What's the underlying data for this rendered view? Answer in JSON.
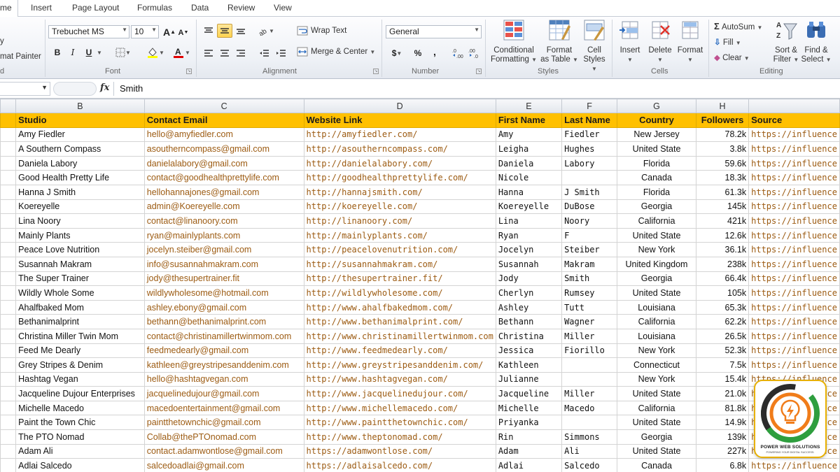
{
  "tabs": [
    {
      "label": "me",
      "active": true
    },
    {
      "label": "Insert"
    },
    {
      "label": "Page Layout"
    },
    {
      "label": "Formulas"
    },
    {
      "label": "Data"
    },
    {
      "label": "Review"
    },
    {
      "label": "View"
    }
  ],
  "clipboard": {
    "cut_partial": "y",
    "format_painter_partial": "mat Painter",
    "label_partial": "d"
  },
  "font": {
    "family": "Trebuchet MS",
    "size": "10",
    "label": "Font",
    "bold": "B",
    "italic": "I",
    "underline": "U"
  },
  "alignment": {
    "wrap_text": "Wrap Text",
    "merge_center": "Merge & Center",
    "label": "Alignment"
  },
  "number": {
    "format": "General",
    "label": "Number",
    "currency": "$",
    "percent": "%",
    "comma": ","
  },
  "styles": {
    "conditional_formatting": [
      "Conditional",
      "Formatting"
    ],
    "format_as_table": [
      "Format",
      "as Table"
    ],
    "cell_styles": [
      "Cell",
      "Styles"
    ],
    "label": "Styles"
  },
  "cells": {
    "insert": "Insert",
    "delete": "Delete",
    "format": "Format",
    "label": "Cells"
  },
  "editing": {
    "autosum": "AutoSum",
    "fill": "Fill",
    "clear": "Clear",
    "sort_filter": [
      "Sort &",
      "Filter"
    ],
    "find_select": [
      "Find &",
      "Select"
    ],
    "label": "Editing"
  },
  "formula_bar": {
    "fx": "fx",
    "value": "Smith"
  },
  "columns": [
    "B",
    "C",
    "D",
    "E",
    "F",
    "G",
    "H",
    ""
  ],
  "header_row": [
    "Studio",
    "Contact Email",
    "Website Link",
    "First Name",
    "Last Name",
    "Country",
    "Followers",
    "Source"
  ],
  "rows": [
    [
      "Amy Fiedler",
      "hello@amyfiedler.com",
      "http://amyfiedler.com/",
      "Amy",
      "Fiedler",
      "New Jersey",
      "78.2k",
      "https://influence"
    ],
    [
      "A Southern Compass",
      "asoutherncompass@gmail.com",
      "http://asoutherncompass.com/",
      "Leigha",
      "Hughes",
      "United State",
      "3.8k",
      "https://influence"
    ],
    [
      "Daniela Labory",
      "danielalabory@gmail.com",
      "http://danielalabory.com/",
      "Daniela",
      "Labory",
      "Florida",
      "59.6k",
      "https://influence"
    ],
    [
      "Good Health Pretty Life",
      "contact@goodhealthprettylife.com",
      "http://goodhealthprettylife.com/",
      "Nicole",
      "",
      "Canada",
      "18.3k",
      "https://influence"
    ],
    [
      "Hanna J Smith",
      "hellohannajones@gmail.com",
      "http://hannajsmith.com/",
      "Hanna",
      "J Smith",
      "Florida",
      "61.3k",
      "https://influence"
    ],
    [
      "Koereyelle",
      "admin@Koereyelle.com",
      "http://koereyelle.com/",
      "Koereyelle",
      "DuBose",
      "Georgia",
      "145k",
      "https://influence"
    ],
    [
      "Lina Noory",
      "contact@linanoory.com",
      "http://linanoory.com/",
      "Lina",
      "Noory",
      "California",
      "421k",
      "https://influence"
    ],
    [
      "Mainly Plants",
      "ryan@mainlyplants.com",
      "http://mainlyplants.com/",
      "Ryan",
      "F",
      "United State",
      "12.6k",
      "https://influence"
    ],
    [
      "Peace Love Nutrition",
      "jocelyn.steiber@gmail.com",
      "http://peacelovenutrition.com/",
      "Jocelyn",
      "Steiber",
      "New York",
      "36.1k",
      "https://influence"
    ],
    [
      "Susannah Makram",
      "info@susannahmakram.com",
      "http://susannahmakram.com/",
      "Susannah",
      "Makram",
      "United Kingdom",
      "238k",
      "https://influence"
    ],
    [
      "The Super Trainer",
      "jody@thesupertrainer.fit",
      "http://thesupertrainer.fit/",
      "Jody",
      "Smith",
      "Georgia",
      "66.4k",
      "https://influence"
    ],
    [
      "Wildly Whole Some",
      "wildlywholesome@hotmail.com",
      "http://wildlywholesome.com/",
      "Cherlyn",
      "Rumsey",
      "United State",
      "105k",
      "https://influence"
    ],
    [
      "Ahalfbaked Mom",
      "ashley.ebony@gmail.com",
      "http://www.ahalfbakedmom.com/",
      "Ashley",
      "Tutt",
      "Louisiana",
      "65.3k",
      "https://influence"
    ],
    [
      "Bethanimalprint",
      "bethann@bethanimalprint.com",
      "http://www.bethanimalprint.com/",
      "Bethann",
      "Wagner",
      "California",
      "62.2k",
      "https://influence"
    ],
    [
      "Christina Miller Twin Mom",
      "contact@christinamillertwinmom.com",
      "http://www.christinamillertwinmom.com",
      "Christina",
      "Miller",
      "Louisiana",
      "26.5k",
      "https://influence"
    ],
    [
      "Feed Me Dearly",
      "feedmedearly@gmail.com",
      "http://www.feedmedearly.com/",
      "Jessica",
      "Fiorillo",
      "New York",
      "52.3k",
      "https://influence"
    ],
    [
      "Grey Stripes & Denim",
      "kathleen@greystripesanddenim.com",
      "http://www.greystripesanddenim.com/",
      "Kathleen",
      "",
      "Connecticut",
      "7.5k",
      "https://influence"
    ],
    [
      "Hashtag Vegan",
      "hello@hashtagvegan.com",
      "http://www.hashtagvegan.com/",
      "Julianne",
      "",
      "New York",
      "15.4k",
      "https://influence"
    ],
    [
      "Jacqueline Dujour Enterprises",
      "jacquelinedujour@gmail.com",
      "http://www.jacquelinedujour.com/",
      "Jacqueline",
      "Miller",
      "United State",
      "21.0k",
      "https://influence"
    ],
    [
      "Michelle Macedo",
      "macedoentertainment@gmail.com",
      "http://www.michellemacedo.com/",
      "Michelle",
      "Macedo",
      "California",
      "81.8k",
      "https://influence"
    ],
    [
      "Paint the Town Chic",
      "paintthetownchic@gmail.com",
      "http://www.paintthetownchic.com/",
      "Priyanka",
      "",
      "United State",
      "14.9k",
      "https://influence"
    ],
    [
      "The PTO Nomad",
      "Collab@thePTOnomad.com",
      "http://www.theptonomad.com/",
      "Rin",
      "Simmons",
      "Georgia",
      "139k",
      "https://influence"
    ],
    [
      "Adam Ali",
      "contact.adamwontlose@gmail.com",
      "https://adamwontlose.com/",
      "Adam",
      "Ali",
      "United State",
      "227k",
      "https://influence"
    ],
    [
      "Adlai Salcedo",
      "salcedoadlai@gmail.com",
      "https://adlaisalcedo.com/",
      "Adlai",
      "Salcedo",
      "Canada",
      "6.8k",
      "https://influence"
    ]
  ],
  "badge": {
    "name": "POWER WEB SOLUTIONS",
    "tagline": "POWERING YOUR DIGITAL SUCCESS."
  },
  "colors": {
    "header_fill": "#ffc000",
    "link_text": "#9c5b12",
    "badge_border": "#e8b000"
  }
}
